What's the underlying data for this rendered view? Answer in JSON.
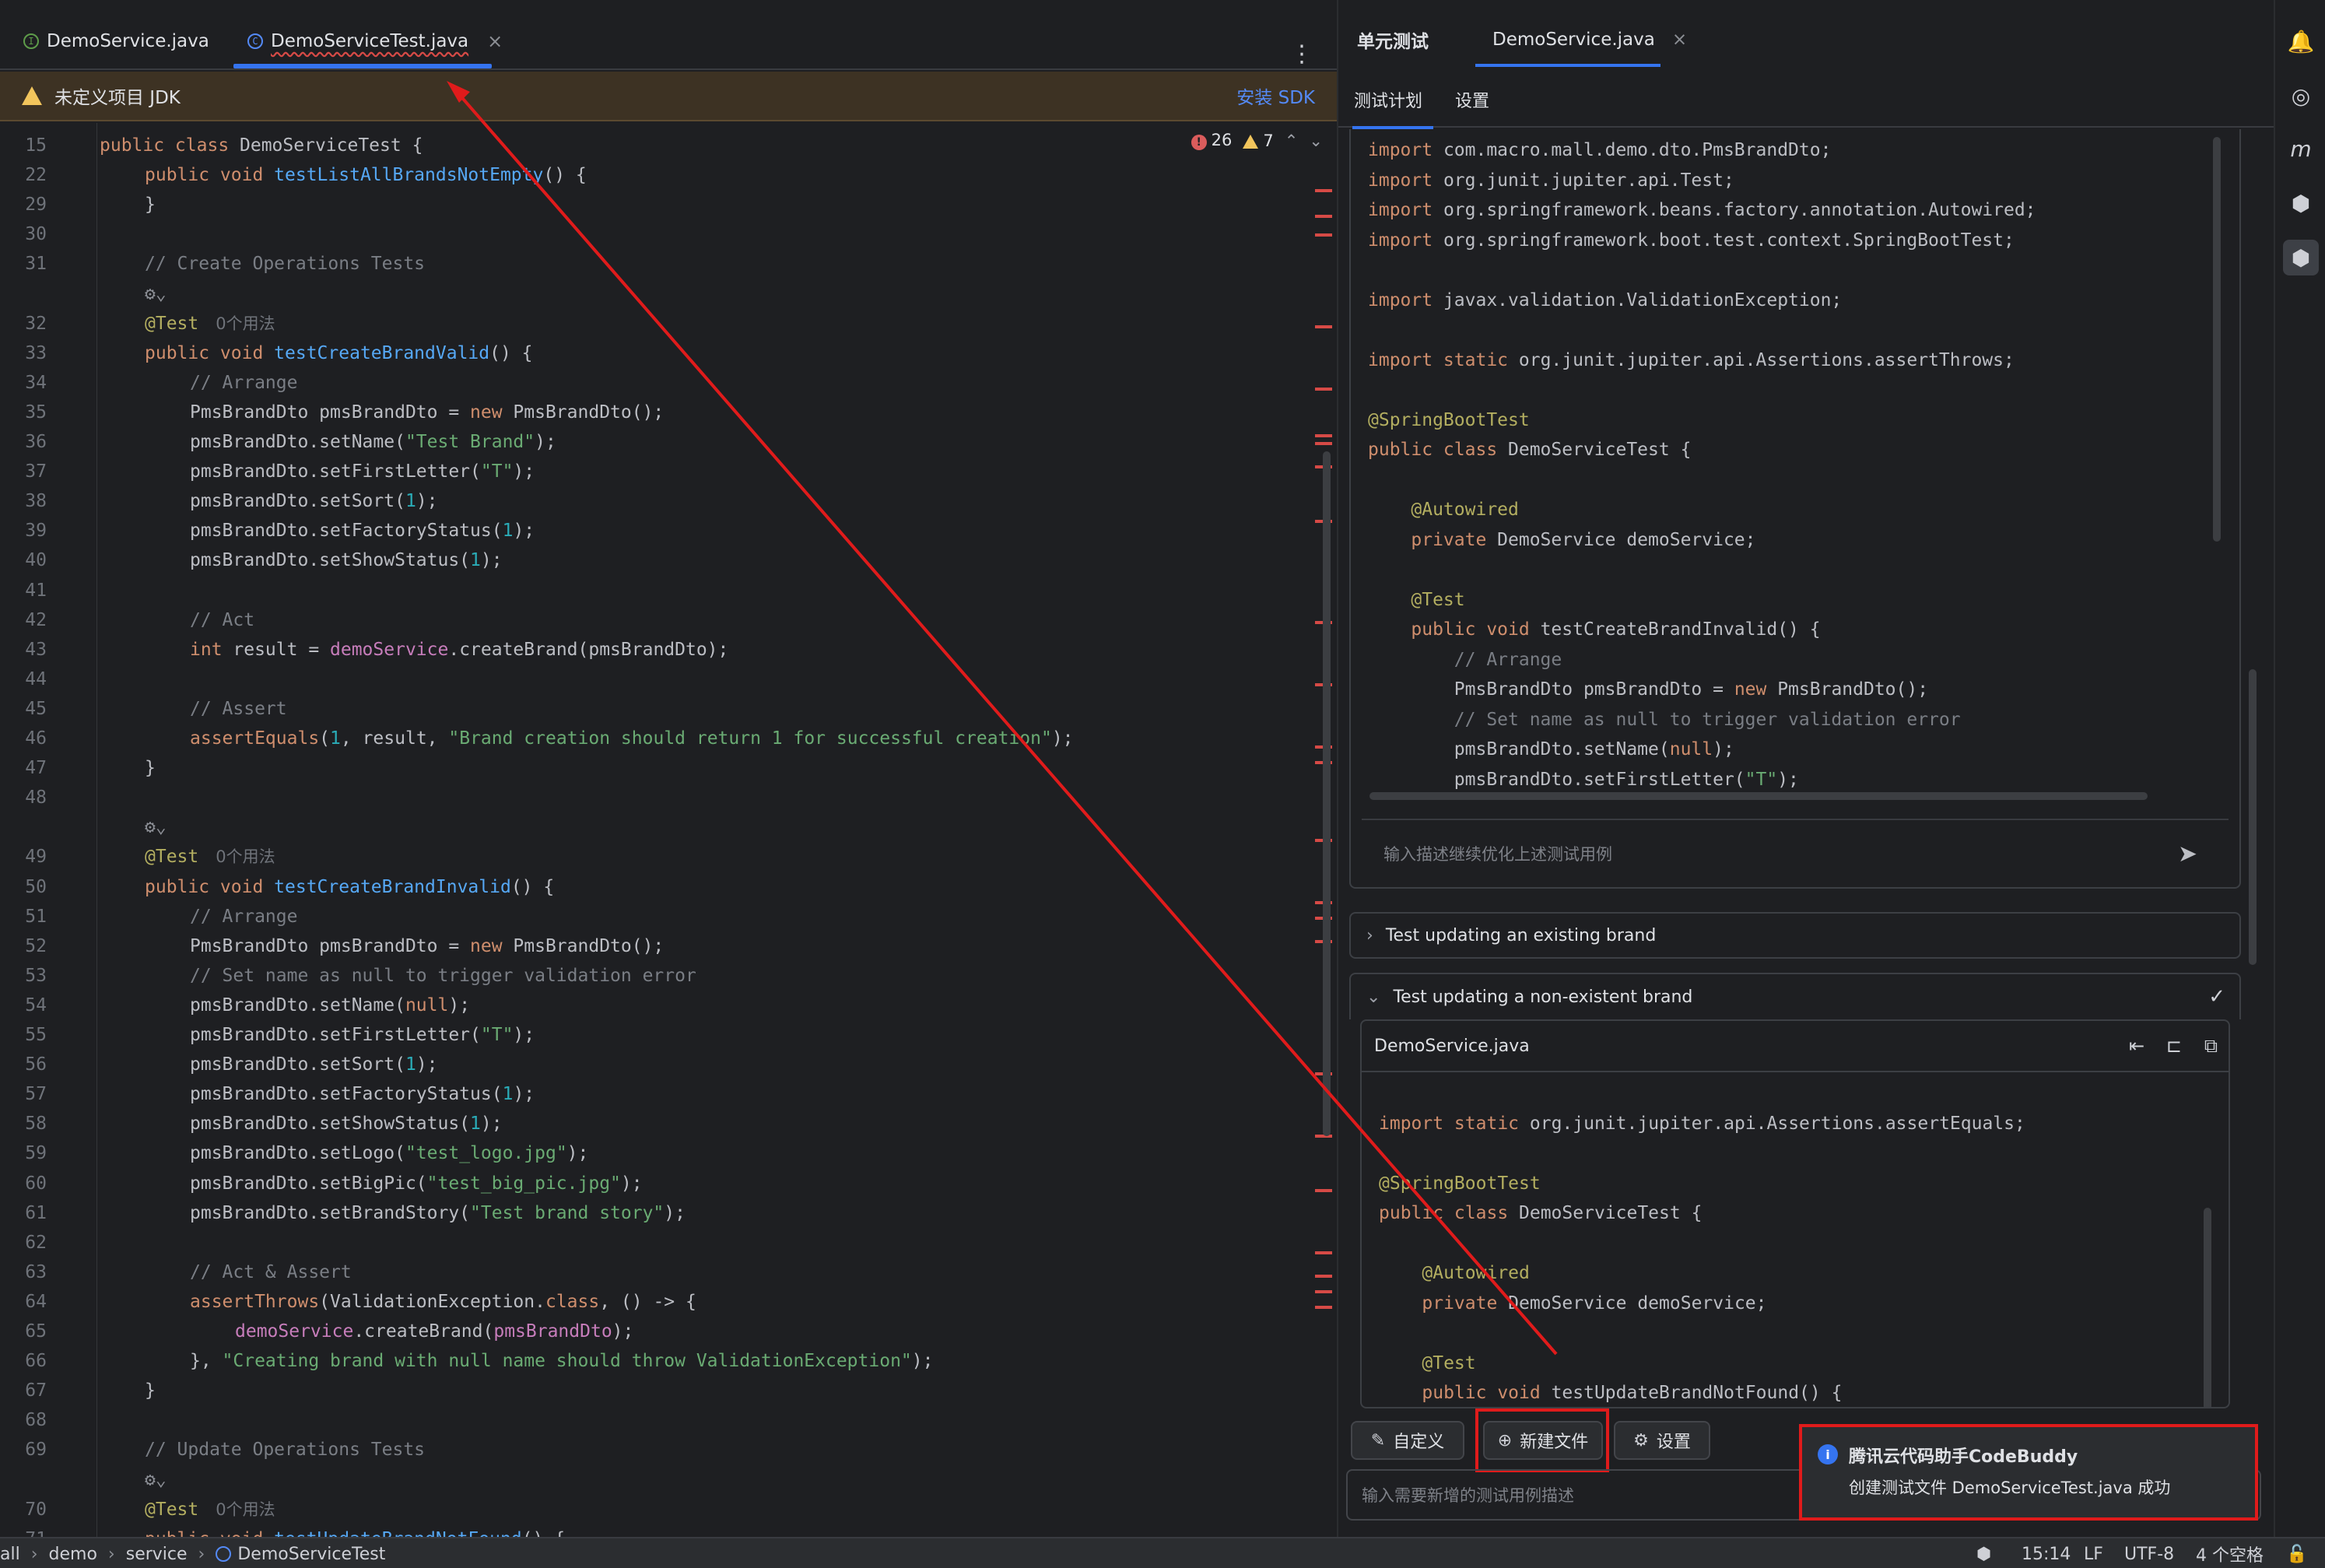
{
  "editor": {
    "tabs": [
      {
        "label": "DemoService.java",
        "kind": "interface",
        "icon": "I"
      },
      {
        "label": "DemoServiceTest.java",
        "kind": "class",
        "icon": "C",
        "active": true,
        "close": "×"
      }
    ],
    "more": "⋮",
    "jdk_banner": {
      "text": "未定义项目 JDK",
      "action": "安装 SDK"
    },
    "indicators": {
      "errors": "26",
      "warnings": "7",
      "error_glyph": "!"
    },
    "inlay_usages": "0个用法",
    "lines": [
      {
        "n": "15",
        "tokens": [
          [
            "kw",
            "public class "
          ],
          [
            "ty",
            "DemoServiceTest"
          ],
          [
            "ty",
            " {"
          ]
        ],
        "indent": 0
      },
      {
        "n": "22",
        "tokens": [
          [
            "kw",
            "public void "
          ],
          [
            "fn",
            "testListAllBrandsNotEmpty"
          ],
          [
            "ty",
            "() {"
          ]
        ],
        "indent": 1
      },
      {
        "n": "29",
        "tokens": [
          [
            "ty",
            "}"
          ]
        ],
        "indent": 1
      },
      {
        "n": "30",
        "tokens": [],
        "indent": 0
      },
      {
        "n": "31",
        "tokens": [
          [
            "cm",
            "// Create Operations Tests"
          ]
        ],
        "indent": 1
      },
      {
        "n": "",
        "tokens": [
          [
            "muted",
            "⚙⌄"
          ]
        ],
        "indent": 1
      },
      {
        "n": "32",
        "tokens": [
          [
            "an",
            "@Test"
          ]
        ],
        "indent": 1,
        "usages": true
      },
      {
        "n": "33",
        "tokens": [
          [
            "kw",
            "public void "
          ],
          [
            "fn",
            "testCreateBrandValid"
          ],
          [
            "ty",
            "() {"
          ]
        ],
        "indent": 1
      },
      {
        "n": "34",
        "tokens": [
          [
            "cm",
            "// Arrange"
          ]
        ],
        "indent": 2
      },
      {
        "n": "35",
        "tokens": [
          [
            "ty",
            "PmsBrandDto pmsBrandDto = "
          ],
          [
            "kw",
            "new "
          ],
          [
            "ty",
            "PmsBrandDto();"
          ]
        ],
        "indent": 2
      },
      {
        "n": "36",
        "tokens": [
          [
            "ty",
            "pmsBrandDto.setName("
          ],
          [
            "str",
            "\"Test Brand\""
          ],
          [
            "ty",
            ");"
          ]
        ],
        "indent": 2
      },
      {
        "n": "37",
        "tokens": [
          [
            "ty",
            "pmsBrandDto.setFirstLetter("
          ],
          [
            "str",
            "\"T\""
          ],
          [
            "ty",
            ");"
          ]
        ],
        "indent": 2
      },
      {
        "n": "38",
        "tokens": [
          [
            "ty",
            "pmsBrandDto.setSort("
          ],
          [
            "num",
            "1"
          ],
          [
            "ty",
            ");"
          ]
        ],
        "indent": 2
      },
      {
        "n": "39",
        "tokens": [
          [
            "ty",
            "pmsBrandDto.setFactoryStatus("
          ],
          [
            "num",
            "1"
          ],
          [
            "ty",
            ");"
          ]
        ],
        "indent": 2
      },
      {
        "n": "40",
        "tokens": [
          [
            "ty",
            "pmsBrandDto.setShowStatus("
          ],
          [
            "num",
            "1"
          ],
          [
            "ty",
            ");"
          ]
        ],
        "indent": 2
      },
      {
        "n": "41",
        "tokens": [],
        "indent": 0
      },
      {
        "n": "42",
        "tokens": [
          [
            "cm",
            "// Act"
          ]
        ],
        "indent": 2
      },
      {
        "n": "43",
        "tokens": [
          [
            "kw",
            "int "
          ],
          [
            "ty",
            "result = "
          ],
          [
            "fld",
            "demoService"
          ],
          [
            "ty",
            ".createBrand(pmsBrandDto);"
          ]
        ],
        "indent": 2
      },
      {
        "n": "44",
        "tokens": [],
        "indent": 0
      },
      {
        "n": "45",
        "tokens": [
          [
            "cm",
            "// Assert"
          ]
        ],
        "indent": 2
      },
      {
        "n": "46",
        "tokens": [
          [
            "kw",
            "assertEquals"
          ],
          [
            "ty",
            "("
          ],
          [
            "num",
            "1"
          ],
          [
            "ty",
            ", result, "
          ],
          [
            "str",
            "\"Brand creation should return 1 for successful creation\""
          ],
          [
            "ty",
            ");"
          ]
        ],
        "indent": 2
      },
      {
        "n": "47",
        "tokens": [
          [
            "ty",
            "}"
          ]
        ],
        "indent": 1
      },
      {
        "n": "48",
        "tokens": [],
        "indent": 0
      },
      {
        "n": "",
        "tokens": [
          [
            "muted",
            "⚙⌄"
          ]
        ],
        "indent": 1
      },
      {
        "n": "49",
        "tokens": [
          [
            "an",
            "@Test"
          ]
        ],
        "indent": 1,
        "usages": true
      },
      {
        "n": "50",
        "tokens": [
          [
            "kw",
            "public void "
          ],
          [
            "fn",
            "testCreateBrandInvalid"
          ],
          [
            "ty",
            "() {"
          ]
        ],
        "indent": 1
      },
      {
        "n": "51",
        "tokens": [
          [
            "cm",
            "// Arrange"
          ]
        ],
        "indent": 2
      },
      {
        "n": "52",
        "tokens": [
          [
            "ty",
            "PmsBrandDto pmsBrandDto = "
          ],
          [
            "kw",
            "new "
          ],
          [
            "ty",
            "PmsBrandDto();"
          ]
        ],
        "indent": 2
      },
      {
        "n": "53",
        "tokens": [
          [
            "cm",
            "// Set name as null to trigger validation error"
          ]
        ],
        "indent": 2
      },
      {
        "n": "54",
        "tokens": [
          [
            "ty",
            "pmsBrandDto.setName("
          ],
          [
            "kw",
            "null"
          ],
          [
            "ty",
            ");"
          ]
        ],
        "indent": 2
      },
      {
        "n": "55",
        "tokens": [
          [
            "ty",
            "pmsBrandDto.setFirstLetter("
          ],
          [
            "str",
            "\"T\""
          ],
          [
            "ty",
            ");"
          ]
        ],
        "indent": 2
      },
      {
        "n": "56",
        "tokens": [
          [
            "ty",
            "pmsBrandDto.setSort("
          ],
          [
            "num",
            "1"
          ],
          [
            "ty",
            ");"
          ]
        ],
        "indent": 2
      },
      {
        "n": "57",
        "tokens": [
          [
            "ty",
            "pmsBrandDto.setFactoryStatus("
          ],
          [
            "num",
            "1"
          ],
          [
            "ty",
            ");"
          ]
        ],
        "indent": 2
      },
      {
        "n": "58",
        "tokens": [
          [
            "ty",
            "pmsBrandDto.setShowStatus("
          ],
          [
            "num",
            "1"
          ],
          [
            "ty",
            ");"
          ]
        ],
        "indent": 2
      },
      {
        "n": "59",
        "tokens": [
          [
            "ty",
            "pmsBrandDto.setLogo("
          ],
          [
            "str",
            "\"test_logo.jpg\""
          ],
          [
            "ty",
            ");"
          ]
        ],
        "indent": 2
      },
      {
        "n": "60",
        "tokens": [
          [
            "ty",
            "pmsBrandDto.setBigPic("
          ],
          [
            "str",
            "\"test_big_pic.jpg\""
          ],
          [
            "ty",
            ");"
          ]
        ],
        "indent": 2
      },
      {
        "n": "61",
        "tokens": [
          [
            "ty",
            "pmsBrandDto.setBrandStory("
          ],
          [
            "str",
            "\"Test brand story\""
          ],
          [
            "ty",
            ");"
          ]
        ],
        "indent": 2
      },
      {
        "n": "62",
        "tokens": [],
        "indent": 0
      },
      {
        "n": "63",
        "tokens": [
          [
            "cm",
            "// Act & Assert"
          ]
        ],
        "indent": 2
      },
      {
        "n": "64",
        "tokens": [
          [
            "kw",
            "assertThrows"
          ],
          [
            "ty",
            "(ValidationException."
          ],
          [
            "kw",
            "class"
          ],
          [
            "ty",
            ", () -> {"
          ]
        ],
        "indent": 2
      },
      {
        "n": "65",
        "tokens": [
          [
            "fld",
            "demoService"
          ],
          [
            "ty",
            ".createBrand("
          ],
          [
            "fld",
            "pmsBrandDto"
          ],
          [
            "ty",
            ");"
          ]
        ],
        "indent": 3
      },
      {
        "n": "66",
        "tokens": [
          [
            "ty",
            "}, "
          ],
          [
            "str",
            "\"Creating brand with null name should throw ValidationException\""
          ],
          [
            "ty",
            ");"
          ]
        ],
        "indent": 2
      },
      {
        "n": "67",
        "tokens": [
          [
            "ty",
            "}"
          ]
        ],
        "indent": 1
      },
      {
        "n": "68",
        "tokens": [],
        "indent": 0
      },
      {
        "n": "69",
        "tokens": [
          [
            "cm",
            "// Update Operations Tests"
          ]
        ],
        "indent": 1
      },
      {
        "n": "",
        "tokens": [
          [
            "muted",
            "⚙⌄"
          ]
        ],
        "indent": 1
      },
      {
        "n": "70",
        "tokens": [
          [
            "an",
            "@Test"
          ]
        ],
        "indent": 1,
        "usages": true
      },
      {
        "n": "71",
        "tokens": [
          [
            "kw",
            "public void "
          ],
          [
            "fn",
            "testUpdateBrandNotFound"
          ],
          [
            "ty",
            "() {"
          ]
        ],
        "indent": 1
      }
    ]
  },
  "panel": {
    "tabs": [
      {
        "label": "单元测试",
        "bold": true
      },
      {
        "label": "DemoService.java",
        "close": "×"
      }
    ],
    "subtabs": [
      "测试计划",
      "设置"
    ],
    "code_top": [
      [
        [
          "kw",
          "import "
        ],
        [
          "ty",
          "com.macro.mall.demo.dto.PmsBrandDto;"
        ]
      ],
      [
        [
          "kw",
          "import "
        ],
        [
          "ty",
          "org.junit.jupiter.api.Test;"
        ]
      ],
      [
        [
          "kw",
          "import "
        ],
        [
          "ty",
          "org.springframework.beans.factory.annotation.Autowired;"
        ]
      ],
      [
        [
          "kw",
          "import "
        ],
        [
          "ty",
          "org.springframework.boot.test.context.SpringBootTest;"
        ]
      ],
      [],
      [
        [
          "kw",
          "import "
        ],
        [
          "ty",
          "javax.validation.ValidationException;"
        ]
      ],
      [],
      [
        [
          "kw",
          "import static "
        ],
        [
          "ty",
          "org.junit.jupiter.api.Assertions.assertThrows;"
        ]
      ],
      [],
      [
        [
          "an",
          "@SpringBootTest"
        ]
      ],
      [
        [
          "kw",
          "public class "
        ],
        [
          "ty",
          "DemoServiceTest {"
        ]
      ],
      [],
      [
        [
          "ty",
          "    "
        ],
        [
          "an",
          "@Autowired"
        ]
      ],
      [
        [
          "ty",
          "    "
        ],
        [
          "kw",
          "private "
        ],
        [
          "ty",
          "DemoService demoService;"
        ]
      ],
      [],
      [
        [
          "ty",
          "    "
        ],
        [
          "an",
          "@Test"
        ]
      ],
      [
        [
          "ty",
          "    "
        ],
        [
          "kw",
          "public void "
        ],
        [
          "ty",
          "testCreateBrandInvalid() {"
        ]
      ],
      [
        [
          "ty",
          "        "
        ],
        [
          "cm",
          "// Arrange"
        ]
      ],
      [
        [
          "ty",
          "        PmsBrandDto pmsBrandDto = "
        ],
        [
          "kw",
          "new "
        ],
        [
          "ty",
          "PmsBrandDto();"
        ]
      ],
      [
        [
          "ty",
          "        "
        ],
        [
          "cm",
          "// Set name as null to trigger validation error"
        ]
      ],
      [
        [
          "ty",
          "        pmsBrandDto.setName("
        ],
        [
          "kw",
          "null"
        ],
        [
          "ty",
          ");"
        ]
      ],
      [
        [
          "ty",
          "        pmsBrandDto.setFirstLetter("
        ],
        [
          "str",
          "\"T\""
        ],
        [
          "ty",
          ");"
        ]
      ]
    ],
    "prompt1_placeholder": "输入描述继续优化上述测试用例",
    "send_icon": "➤",
    "section_collapsed": "Test updating an existing brand",
    "section_expanded": "Test updating a non-existent brand",
    "section_check": "✓",
    "file_header": "DemoService.java",
    "file_actions": [
      "⇤",
      "⊏",
      "⧉"
    ],
    "code_bottom": [
      [],
      [
        [
          "kw",
          "import static "
        ],
        [
          "ty",
          "org.junit.jupiter.api.Assertions.assertEquals;"
        ]
      ],
      [],
      [
        [
          "an",
          "@SpringBootTest"
        ]
      ],
      [
        [
          "kw",
          "public class "
        ],
        [
          "ty",
          "DemoServiceTest {"
        ]
      ],
      [],
      [
        [
          "ty",
          "    "
        ],
        [
          "an",
          "@Autowired"
        ]
      ],
      [
        [
          "ty",
          "    "
        ],
        [
          "kw",
          "private "
        ],
        [
          "ty",
          "DemoService demoService;"
        ]
      ],
      [],
      [
        [
          "ty",
          "    "
        ],
        [
          "an",
          "@Test"
        ]
      ],
      [
        [
          "ty",
          "    "
        ],
        [
          "kw",
          "public void "
        ],
        [
          "ty",
          "testUpdateBrandNotFound() {"
        ]
      ]
    ],
    "buttons": {
      "customize": "自定义",
      "new_file": "新建文件",
      "settings": "设置"
    },
    "button_icons": {
      "customize": "✎",
      "new_file": "⊕",
      "settings": "⚙"
    },
    "prompt2_placeholder": "输入需要新增的测试用例描述",
    "notification": {
      "title": "腾讯云代码助手CodeBuddy",
      "body": "创建测试文件 DemoServiceTest.java 成功",
      "icon": "i"
    }
  },
  "toolstrip": [
    "🔔",
    "◎",
    "m",
    "⬢",
    "⬢"
  ],
  "statusbar": {
    "breadcrumb": [
      "all",
      "demo",
      "service",
      "DemoServiceTest"
    ],
    "separator": "›",
    "right": {
      "logo": "⬢",
      "position": "15:14",
      "line_ending": "LF",
      "encoding": "UTF-8",
      "indent": "4 个空格",
      "lock": "🔓"
    }
  },
  "colors": {
    "accent": "#3574f0",
    "annotation_red": "#e01b1b",
    "error": "#db5c5c",
    "warning": "#f2c55c"
  }
}
